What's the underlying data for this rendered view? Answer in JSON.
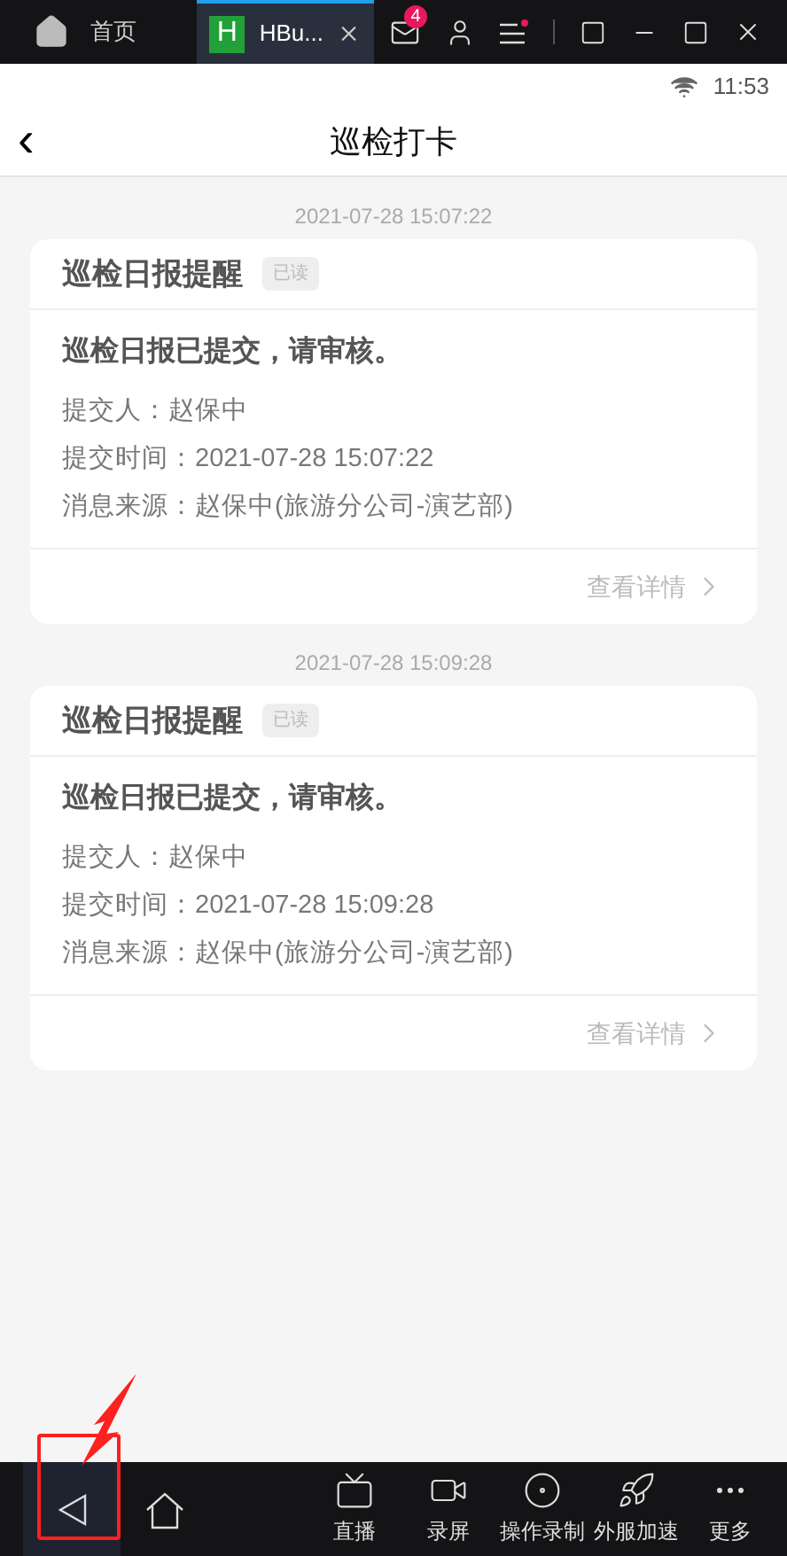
{
  "emulator_bar": {
    "home_tab": "首页",
    "app_tab": {
      "label": "HBu...",
      "icon_letter": "H",
      "selected": true
    },
    "mail_badge": "4"
  },
  "status_bar": {
    "time": "11:53"
  },
  "header": {
    "back": "‹",
    "title": "巡检打卡"
  },
  "messages": [
    {
      "timestamp": "2021-07-28 15:07:22",
      "title": "巡检日报提醒",
      "tag": "已读",
      "headline": "巡检日报已提交，请审核。",
      "lines": [
        "提交人：赵保中",
        "提交时间：2021-07-28 15:07:22",
        "消息来源：赵保中(旅游分公司-演艺部)"
      ],
      "link": "查看详情"
    },
    {
      "timestamp": "2021-07-28 15:09:28",
      "title": "巡检日报提醒",
      "tag": "已读",
      "headline": "巡检日报已提交，请审核。",
      "lines": [
        "提交人：赵保中",
        "提交时间：2021-07-28 15:09:28",
        "消息来源：赵保中(旅游分公司-演艺部)"
      ],
      "link": "查看详情"
    }
  ],
  "toolbar": [
    {
      "kind": "tv",
      "label": "直播"
    },
    {
      "kind": "camera",
      "label": "录屏"
    },
    {
      "kind": "record",
      "label": "操作录制"
    },
    {
      "kind": "rocket",
      "label": "外服加速"
    },
    {
      "kind": "more",
      "label": "更多"
    }
  ]
}
